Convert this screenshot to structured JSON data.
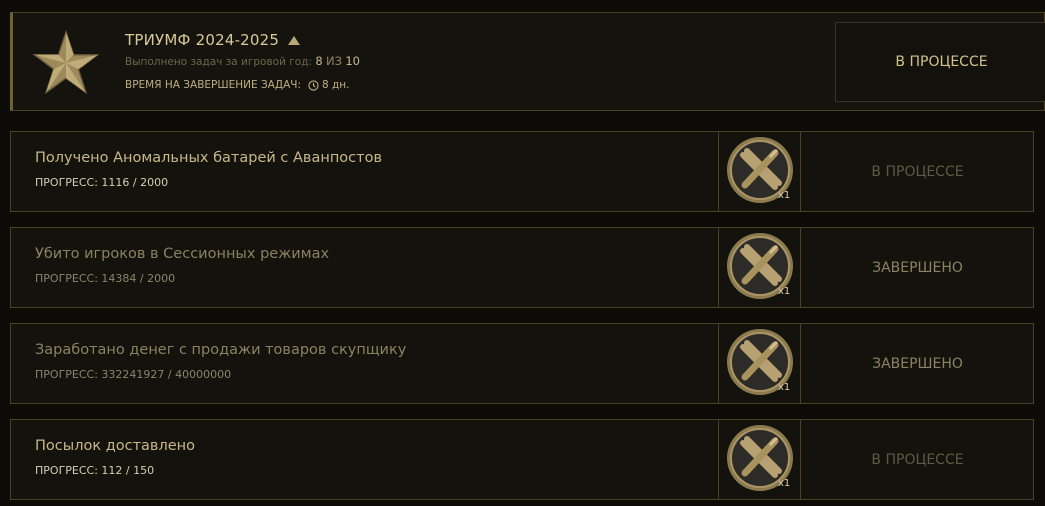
{
  "header": {
    "title": "ТРИУМФ 2024-2025",
    "sub_prefix": "Выполнено задач за игровой год:",
    "done_count": "8",
    "of_label": "ИЗ",
    "total_count": "10",
    "time_label": "ВРЕМЯ НА ЗАВЕРШЕНИЕ ЗАДАЧ:",
    "time_value": "8 дн.",
    "status": "В ПРОЦЕССЕ"
  },
  "tasks": [
    {
      "name": "Получено Аномальных батарей с Аванпостов",
      "progress": "ПРОГРЕСС: 1116 / 2000",
      "reward_qty": "x1",
      "status": "В ПРОЦЕССЕ"
    },
    {
      "name": "Убито игроков в Сессионных режимах",
      "progress": "ПРОГРЕСС: 14384 / 2000",
      "reward_qty": "x1",
      "status": "ЗАВЕРШЕНО"
    },
    {
      "name": "Заработано денег с продажи товаров скупщику",
      "progress": "ПРОГРЕСС: 332241927 / 40000000",
      "reward_qty": "x1",
      "status": "ЗАВЕРШЕНО"
    },
    {
      "name": "Посылок доставлено",
      "progress": "ПРОГРЕСС: 112 / 150",
      "reward_qty": "x1",
      "status": "В ПРОЦЕССЕ"
    }
  ],
  "icons": {
    "header": "star-emblem-icon",
    "reward": "crossed-tools-coin-icon",
    "time": "clock-icon",
    "toggle": "caret-up-icon"
  },
  "colors": {
    "accent": "#c8b78a",
    "border": "#4b4224",
    "background": "#0c0b08"
  }
}
